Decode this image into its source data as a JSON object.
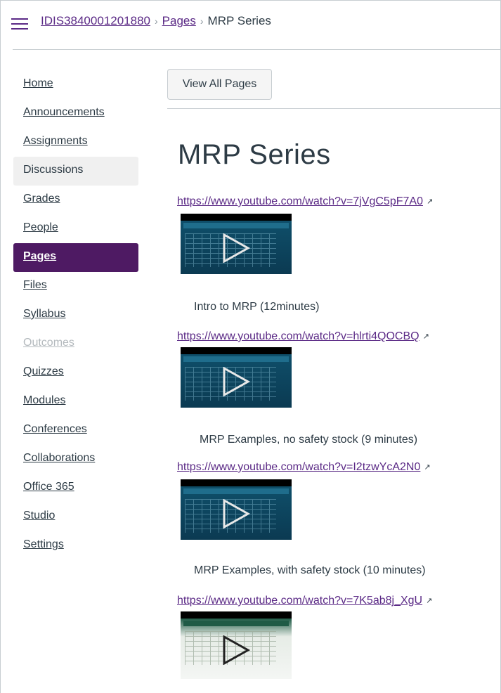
{
  "header": {
    "breadcrumb": {
      "course": "IDIS3840001201880",
      "section": "Pages",
      "current": "MRP Series",
      "separator": "›"
    }
  },
  "sidebar": {
    "items": [
      {
        "label": "Home"
      },
      {
        "label": "Announcements"
      },
      {
        "label": "Assignments"
      },
      {
        "label": "Discussions"
      },
      {
        "label": "Grades"
      },
      {
        "label": "People"
      },
      {
        "label": "Pages"
      },
      {
        "label": "Files"
      },
      {
        "label": "Syllabus"
      },
      {
        "label": "Outcomes"
      },
      {
        "label": "Quizzes"
      },
      {
        "label": "Modules"
      },
      {
        "label": "Conferences"
      },
      {
        "label": "Collaborations"
      },
      {
        "label": "Office 365"
      },
      {
        "label": "Studio"
      },
      {
        "label": "Settings"
      }
    ],
    "active": "Pages"
  },
  "main": {
    "view_all_label": "View All Pages",
    "title": "MRP Series",
    "videos": [
      {
        "url": "https://www.youtube.com/watch?v=7jVgC5pF7A0",
        "caption": "Intro to MRP (12minutes)"
      },
      {
        "url": "https://www.youtube.com/watch?v=hlrti4QOCBQ",
        "caption": "MRP Examples, no safety stock (9 minutes)"
      },
      {
        "url": "https://www.youtube.com/watch?v=I2tzwYcA2N0",
        "caption": "MRP Examples, with safety stock (10 minutes)"
      },
      {
        "url": "https://www.youtube.com/watch?v=7K5ab8j_XgU",
        "caption": ""
      }
    ]
  },
  "icons": {
    "external_link": "external-link-icon",
    "play": "play-icon",
    "menu": "hamburger-menu-icon"
  },
  "colors": {
    "brand": "#5b2a86",
    "active_nav": "#4e1a63",
    "text": "#2d3b45"
  }
}
